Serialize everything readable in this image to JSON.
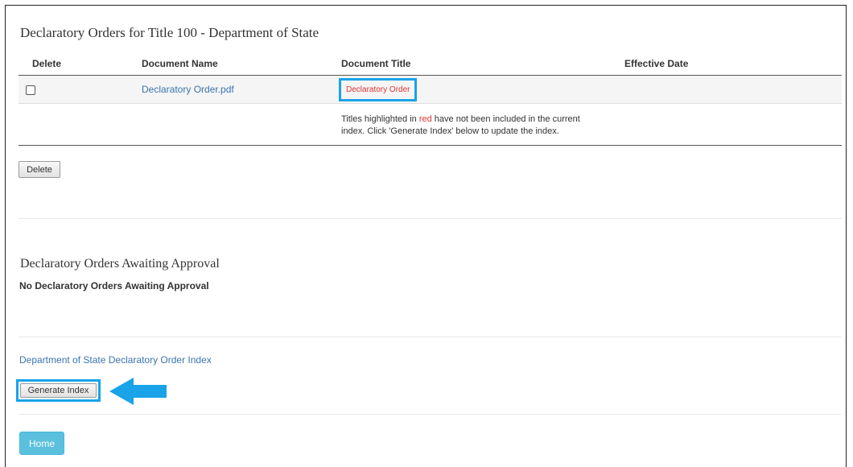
{
  "section1": {
    "title": "Declaratory Orders for Title 100 - Department of State",
    "columns": {
      "delete": "Delete",
      "doc_name": "Document Name",
      "doc_title": "Document Title",
      "effective": "Effective Date"
    },
    "rows": [
      {
        "doc_name": "Declaratory Order.pdf",
        "doc_title": "Declaratory Order",
        "effective": ""
      }
    ],
    "note_pre": "Titles highlighted in ",
    "note_red": "red",
    "note_post_line1": " have not been included in the current",
    "note_line2": "index. Click 'Generate Index' below to update the index.",
    "delete_button": "Delete"
  },
  "section2": {
    "title": "Declaratory Orders Awaiting Approval",
    "empty_text": "No Declaratory Orders Awaiting Approval"
  },
  "index": {
    "link": "Department of State Declaratory Order Index",
    "generate_button": "Generate Index"
  },
  "home_button": "Home",
  "colors": {
    "highlight": "#1aa3e8",
    "link": "#3a74b0",
    "red": "#e23333",
    "home": "#5bc0de"
  }
}
